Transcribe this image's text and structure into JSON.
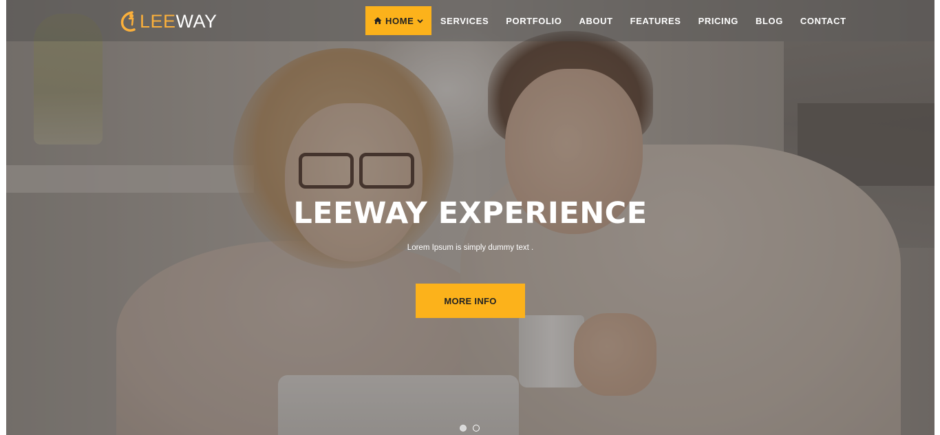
{
  "brand": {
    "logo_part1": "LEE",
    "logo_part2": "WAY",
    "primary_color": "#fcb21b"
  },
  "nav": {
    "items": [
      {
        "label": "HOME",
        "active": true,
        "icon": "home-icon",
        "has_dropdown": true
      },
      {
        "label": "SERVICES",
        "active": false
      },
      {
        "label": "PORTFOLIO",
        "active": false
      },
      {
        "label": "ABOUT",
        "active": false
      },
      {
        "label": "FEATURES",
        "active": false
      },
      {
        "label": "PRICING",
        "active": false
      },
      {
        "label": "BLOG",
        "active": false
      },
      {
        "label": "CONTACT",
        "active": false
      }
    ]
  },
  "hero": {
    "title": "LEEWAY EXPERIENCE",
    "subtitle": "Lorem Ipsum is simply dummy text .",
    "button_label": "MORE INFO"
  },
  "slider": {
    "total_slides": 2,
    "active_index": 0
  }
}
